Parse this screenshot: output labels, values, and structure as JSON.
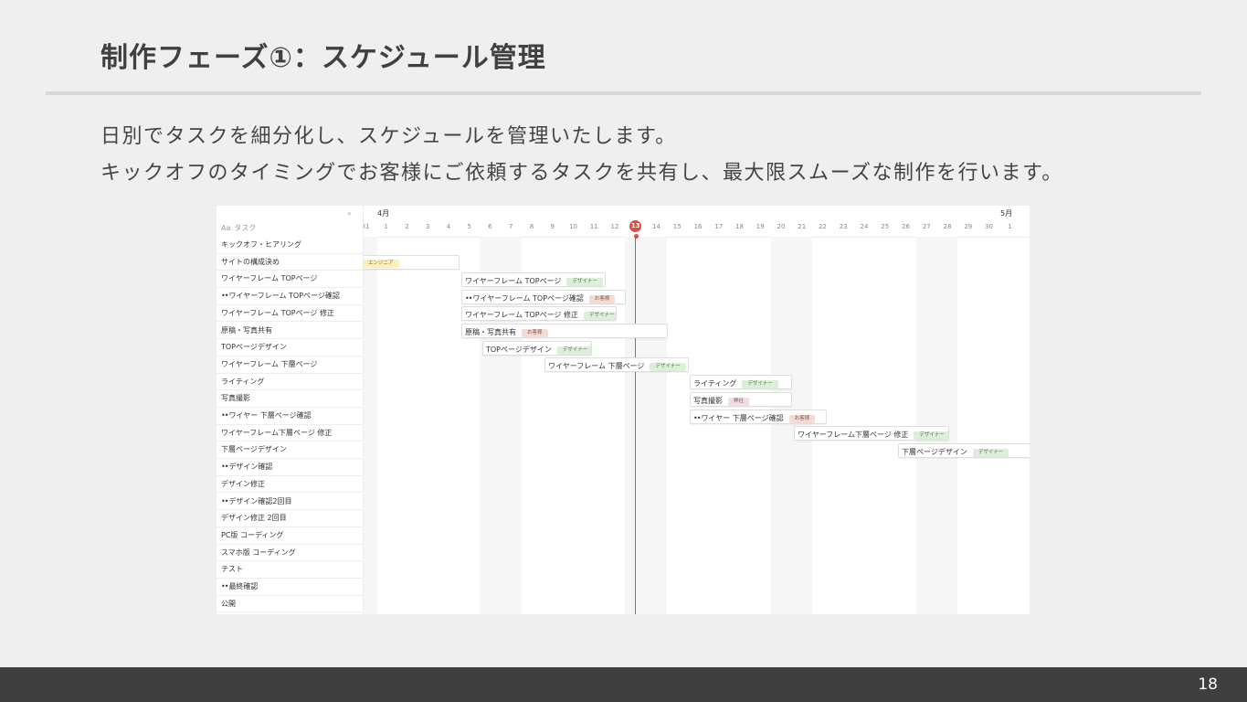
{
  "page": {
    "title": "制作フェーズ①：スケジュール管理",
    "desc_line1": "日別でタスクを細分化し、スケジュールを管理いたします。",
    "desc_line2": "キックオフのタイミングでお客様にご依頼するタスクを共有し、最大限スムーズな制作を行います。",
    "page_number": "18"
  },
  "gantt": {
    "collapse_icon": "«",
    "aa_label": "Aa",
    "column_title": "タスク",
    "month_april": "4月",
    "month_may": "5月",
    "today_label": "13",
    "days": [
      "31",
      "1",
      "2",
      "3",
      "4",
      "5",
      "6",
      "7",
      "8",
      "9",
      "10",
      "11",
      "12",
      "13",
      "14",
      "15",
      "16",
      "17",
      "18",
      "19",
      "20",
      "21",
      "22",
      "23",
      "24",
      "25",
      "26",
      "27",
      "28",
      "29",
      "30",
      "1"
    ],
    "tasks": [
      {
        "eyes": "",
        "label": "キックオフ・ヒアリング"
      },
      {
        "eyes": "",
        "label": "サイトの構成決め"
      },
      {
        "eyes": "",
        "label": "ワイヤーフレーム TOPページ"
      },
      {
        "eyes": "••",
        "label": "ワイヤーフレーム TOPページ確認"
      },
      {
        "eyes": "",
        "label": "ワイヤーフレーム TOPページ 修正"
      },
      {
        "eyes": "",
        "label": "原稿・写真共有"
      },
      {
        "eyes": "",
        "label": "TOPページデザイン"
      },
      {
        "eyes": "",
        "label": "ワイヤーフレーム 下層ページ"
      },
      {
        "eyes": "",
        "label": "ライティング"
      },
      {
        "eyes": "",
        "label": "写真撮影"
      },
      {
        "eyes": "••",
        "label": "ワイヤー 下層ページ確認"
      },
      {
        "eyes": "",
        "label": "ワイヤーフレーム下層ページ 修正"
      },
      {
        "eyes": "",
        "label": "下層ページデザイン"
      },
      {
        "eyes": "••",
        "label": "デザイン確認"
      },
      {
        "eyes": "",
        "label": "デザイン修正"
      },
      {
        "eyes": "••",
        "label": "デザイン確認2回目"
      },
      {
        "eyes": "",
        "label": "デザイン修正 2回目"
      },
      {
        "eyes": "",
        "label": "PC版 コーディング"
      },
      {
        "eyes": "",
        "label": "スマホ版 コーディング"
      },
      {
        "eyes": "",
        "label": "テスト"
      },
      {
        "eyes": "••",
        "label": "最終確認"
      },
      {
        "eyes": "",
        "label": "公開"
      }
    ],
    "bars": [
      {
        "label": "",
        "tag": "エンジニア",
        "tag_type": "eng"
      },
      {
        "label": "ワイヤーフレーム TOPページ",
        "tag": "デザイナー",
        "tag_type": "design"
      },
      {
        "label": "ワイヤーフレーム TOPページ確認",
        "eyes": "••",
        "tag": "お客様",
        "tag_type": "client"
      },
      {
        "label": "ワイヤーフレーム TOPページ 修正",
        "tag": "デザイナー",
        "tag_type": "design"
      },
      {
        "label": "原稿・写真共有",
        "tag": "お客様",
        "tag_type": "client"
      },
      {
        "label": "TOPページデザイン",
        "tag": "デザイナー",
        "tag_type": "design"
      },
      {
        "label": "ワイヤーフレーム 下層ページ",
        "tag": "デザイナー",
        "tag_type": "design"
      },
      {
        "label": "ライティング",
        "tag": "デザイナー",
        "tag_type": "design"
      },
      {
        "label": "写真撮影",
        "tag": "弊社",
        "tag_type": "own"
      },
      {
        "label": "ワイヤー 下層ページ確認",
        "eyes": "••",
        "tag": "お客様",
        "tag_type": "client"
      },
      {
        "label": "ワイヤーフレーム下層ページ 修正",
        "tag": "デザイナー",
        "tag_type": "design"
      },
      {
        "label": "下層ページデザイン",
        "tag": "デザイナー",
        "tag_type": "design"
      }
    ]
  }
}
